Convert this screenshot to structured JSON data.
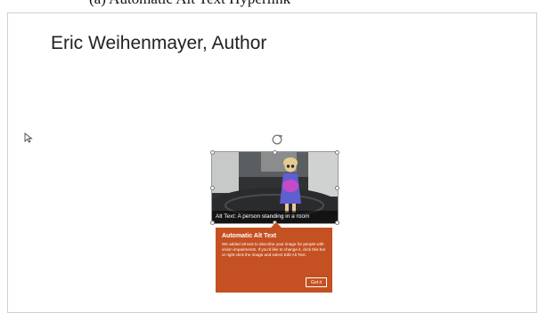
{
  "header_caption": "(a) Automatic Alt Text Hyperlink",
  "slide": {
    "title": "Eric Weihenmayer, Author"
  },
  "image": {
    "alt_text": "Alt Text: A person standing in a room"
  },
  "callout": {
    "title": "Automatic Alt Text",
    "body": "We added alt text to describe your image for people with vision impairments. If you'd like to change it, click this bar or right-click the image and select Edit Alt Text.",
    "button": "Got it",
    "color": "#c55122"
  },
  "icons": {
    "cursor": "mouse-pointer-icon",
    "rotate": "rotate-handle-icon"
  }
}
